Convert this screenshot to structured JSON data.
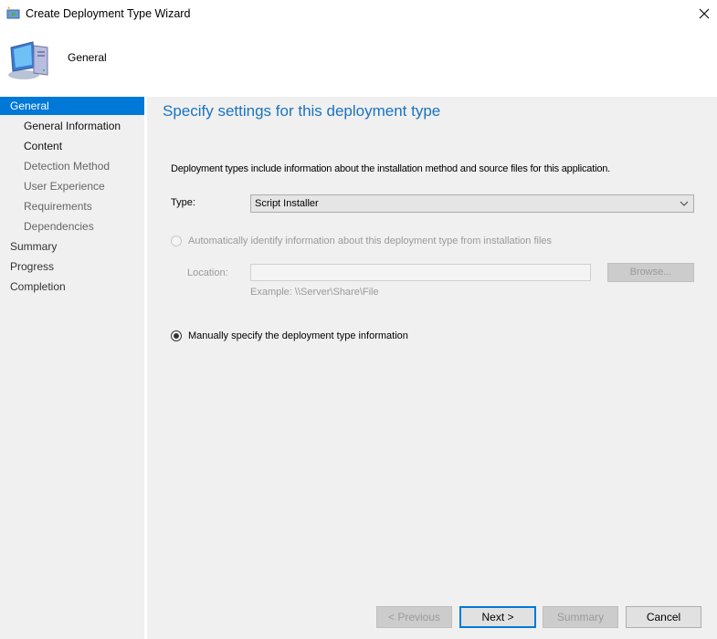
{
  "window": {
    "title": "Create Deployment Type Wizard",
    "close_icon": "close-icon"
  },
  "header": {
    "icon": "computer-icon",
    "label": "General"
  },
  "sidebar": {
    "items": [
      {
        "label": "General",
        "level": 0,
        "active": true
      },
      {
        "label": "General Information",
        "level": 1,
        "done": true
      },
      {
        "label": "Content",
        "level": 1,
        "done": true
      },
      {
        "label": "Detection Method",
        "level": 1
      },
      {
        "label": "User Experience",
        "level": 1
      },
      {
        "label": "Requirements",
        "level": 1
      },
      {
        "label": "Dependencies",
        "level": 1
      },
      {
        "label": "Summary",
        "level": 0
      },
      {
        "label": "Progress",
        "level": 0
      },
      {
        "label": "Completion",
        "level": 0
      }
    ]
  },
  "main": {
    "title": "Specify settings for this deployment type",
    "description": "Deployment types include information about the installation method and source files for this application.",
    "type_label": "Type:",
    "type_value": "Script Installer",
    "auto_option": {
      "label": "Automatically identify information about this deployment type from installation files",
      "checked": false,
      "enabled": false
    },
    "location_label": "Location:",
    "location_value": "",
    "location_example": "Example: \\\\Server\\Share\\File",
    "browse_label": "Browse...",
    "manual_option": {
      "label": "Manually specify the deployment type information",
      "checked": true,
      "enabled": true
    }
  },
  "footer": {
    "previous_label": "< Previous",
    "next_label": "Next >",
    "summary_label": "Summary",
    "cancel_label": "Cancel"
  },
  "colors": {
    "accent": "#0078d7",
    "title": "#1a73c2",
    "panel": "#f0f0f0"
  }
}
